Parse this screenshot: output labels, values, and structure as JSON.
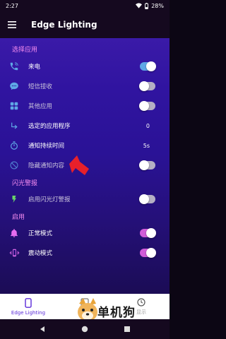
{
  "status": {
    "time": "2:27",
    "battery": "28%"
  },
  "app": {
    "title": "Edge Lighting"
  },
  "sections": {
    "select_app": "选择应用",
    "flash_alert": "闪光警报",
    "enable": "启用"
  },
  "rows": {
    "incoming_call": "来电",
    "sms": "短信接收",
    "other_apps": "其他应用",
    "selected_apps": "选定的应用程序",
    "selected_apps_value": "0",
    "notify_duration": "通知持续时间",
    "notify_duration_value": "5s",
    "hide_content": "隐藏通知内容",
    "flash_enable": "启用闪光灯警报",
    "normal_mode": "正常模式",
    "vibrate_mode": "震动模式"
  },
  "toggles": {
    "incoming_call": true,
    "sms": false,
    "other_apps": false,
    "hide_content": false,
    "flash_enable": false,
    "normal_mode": true,
    "vibrate_mode": true
  },
  "bottom_nav": {
    "edge_lighting": "Edge Lighting",
    "item2": "呕",
    "item3": "显示"
  },
  "watermark": {
    "text": "单机狗"
  },
  "colors": {
    "accent": "#f58cf0",
    "toggle_blue": "#5fa8e6",
    "toggle_pink": "#d05cd8",
    "nav_active": "#5a2ad8",
    "arrow": "#e8202a"
  }
}
